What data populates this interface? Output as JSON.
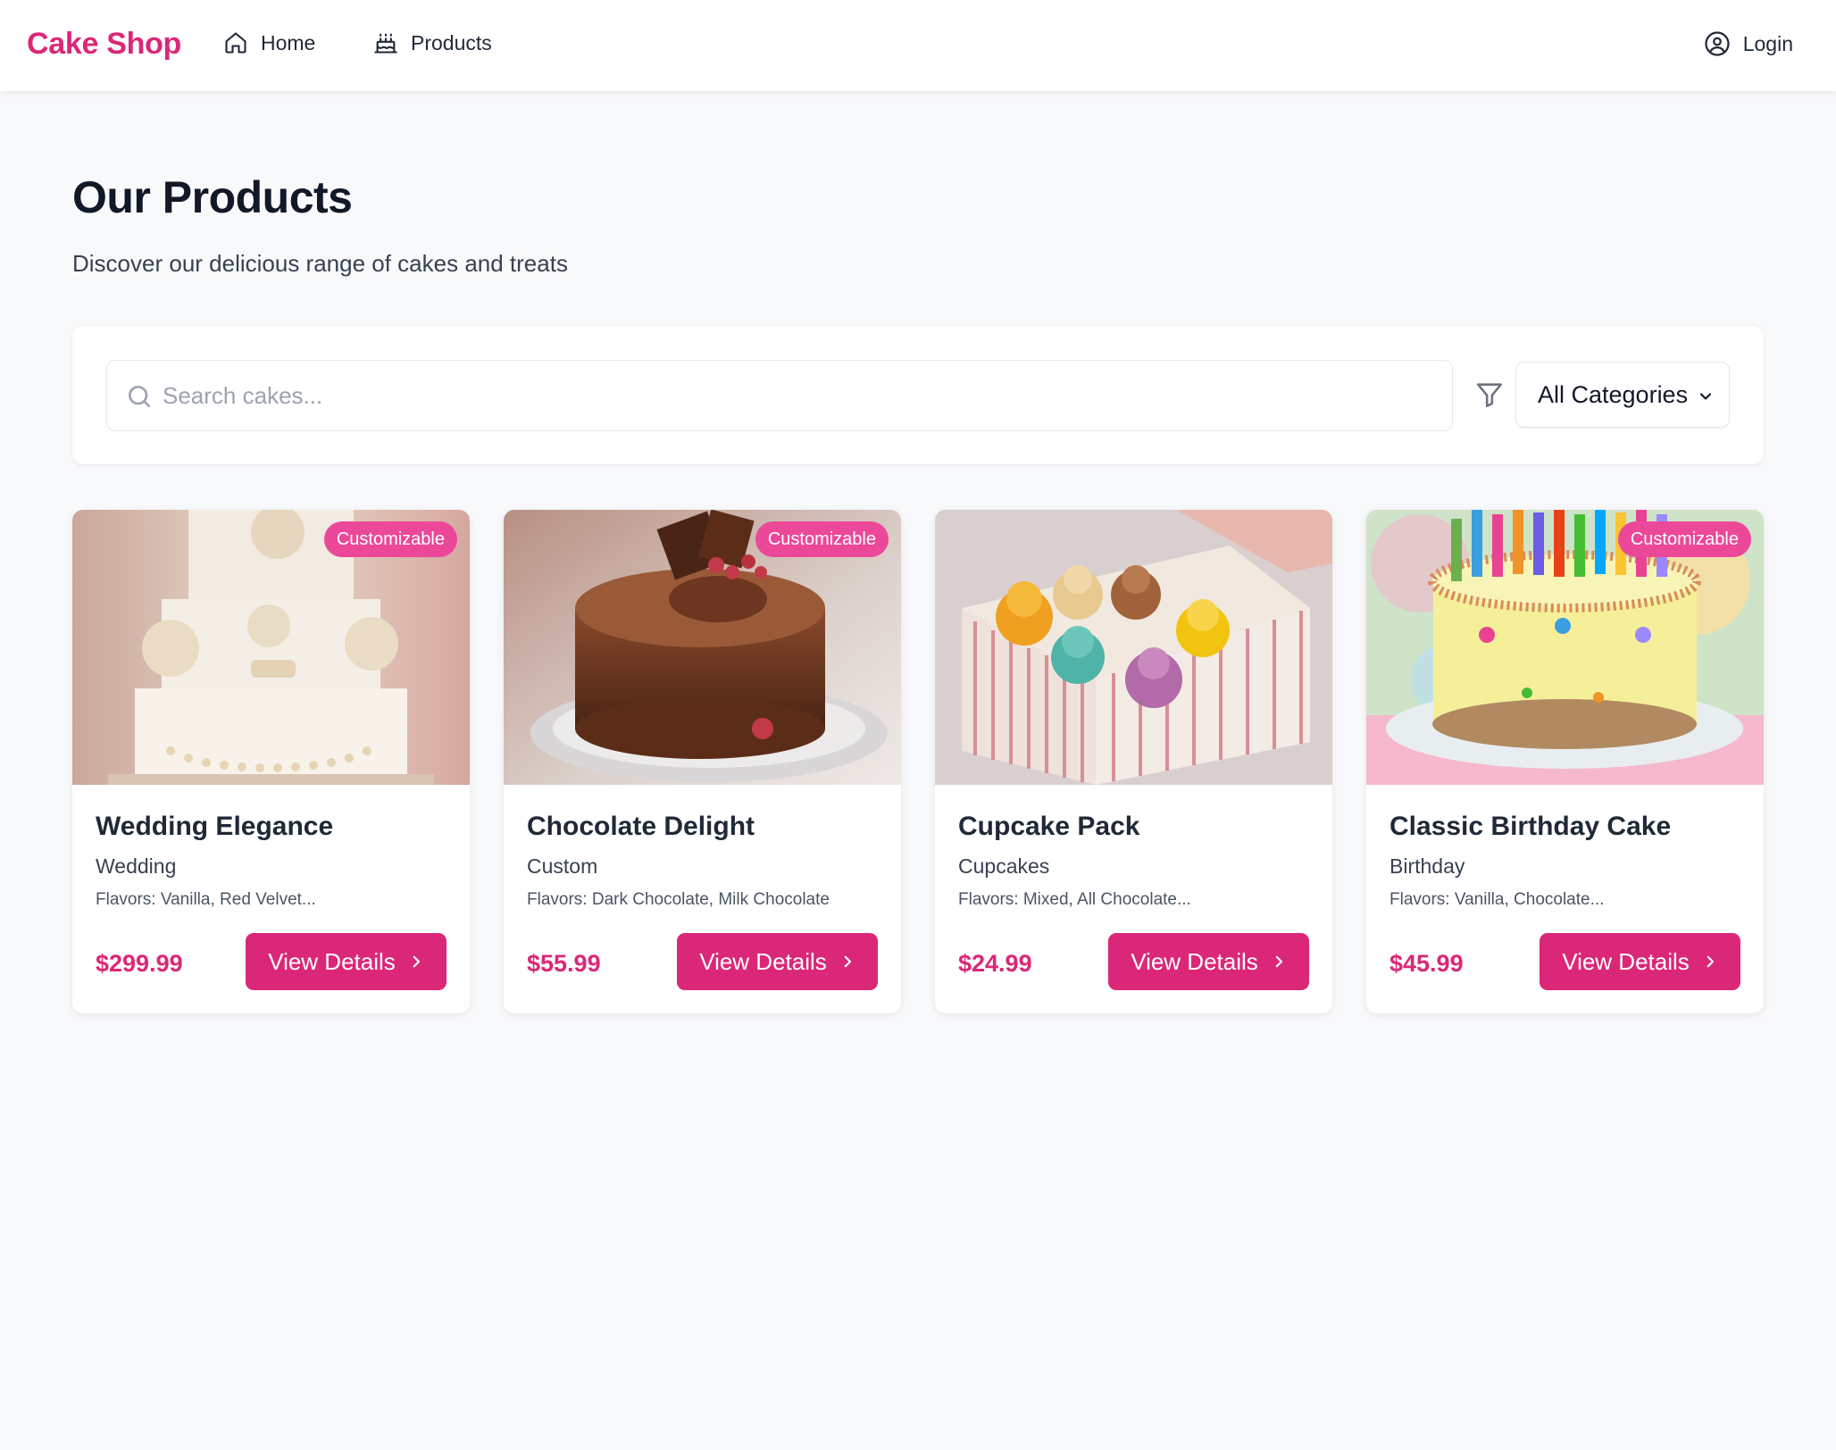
{
  "header": {
    "brand": "Cake Shop",
    "nav": [
      {
        "label": "Home",
        "icon": "home-icon"
      },
      {
        "label": "Products",
        "icon": "cake-icon"
      }
    ],
    "login_label": "Login",
    "login_icon": "user-circle-icon"
  },
  "page": {
    "title": "Our Products",
    "subtitle": "Discover our delicious range of cakes and treats"
  },
  "search": {
    "placeholder": "Search cakes...",
    "value": "",
    "category_selected": "All Categories"
  },
  "products": [
    {
      "name": "Wedding Elegance",
      "category": "Wedding",
      "flavors": "Flavors: Vanilla, Red Velvet...",
      "price": "$299.99",
      "badge": "Customizable",
      "button": "View Details"
    },
    {
      "name": "Chocolate Delight",
      "category": "Custom",
      "flavors": "Flavors: Dark Chocolate, Milk Chocolate",
      "price": "$55.99",
      "badge": "Customizable",
      "button": "View Details"
    },
    {
      "name": "Cupcake Pack",
      "category": "Cupcakes",
      "flavors": "Flavors: Mixed, All Chocolate...",
      "price": "$24.99",
      "badge": "",
      "button": "View Details"
    },
    {
      "name": "Classic Birthday Cake",
      "category": "Birthday",
      "flavors": "Flavors: Vanilla, Chocolate...",
      "price": "$45.99",
      "badge": "Customizable",
      "button": "View Details"
    }
  ],
  "colors": {
    "brand": "#db2777",
    "badge": "#ec4899",
    "background": "#f8f9fb"
  }
}
